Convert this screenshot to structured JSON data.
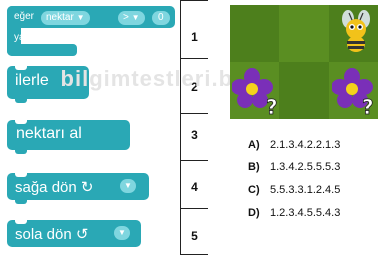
{
  "blocks": {
    "if_block": {
      "keyword": "eğer",
      "dropdown1": "nektar",
      "dropdown2": ">",
      "value": "0",
      "do_label": "yap"
    },
    "move_forward": "ilerle",
    "get_nectar": "nektarı al",
    "turn_right": "sağa dön ↻",
    "turn_left": "sola dön ↺"
  },
  "row_numbers": [
    "1",
    "2",
    "3",
    "4",
    "5"
  ],
  "watermark": "bilgimtestleri.blogspot",
  "game": {
    "sprites": [
      "bee-icon",
      "flower-question-icon",
      "flower-question-icon"
    ],
    "colors": {
      "grass_dark": "#4d7f1c",
      "grass_light": "#5a8e22",
      "petal": "#7a2fb8",
      "bee": "#f2c21a"
    }
  },
  "options": [
    {
      "letter": "A)",
      "text": "2.1.3.4.2.2.1.3"
    },
    {
      "letter": "B)",
      "text": "1.3.4.2.5.5.5.3"
    },
    {
      "letter": "C)",
      "text": "5.5.3.3.1.2.4.5"
    },
    {
      "letter": "D)",
      "text": "1.2.3.4.5.5.4.3"
    }
  ],
  "colors": {
    "block": "#2aa8b5",
    "dropdown": "#7fd6df"
  }
}
